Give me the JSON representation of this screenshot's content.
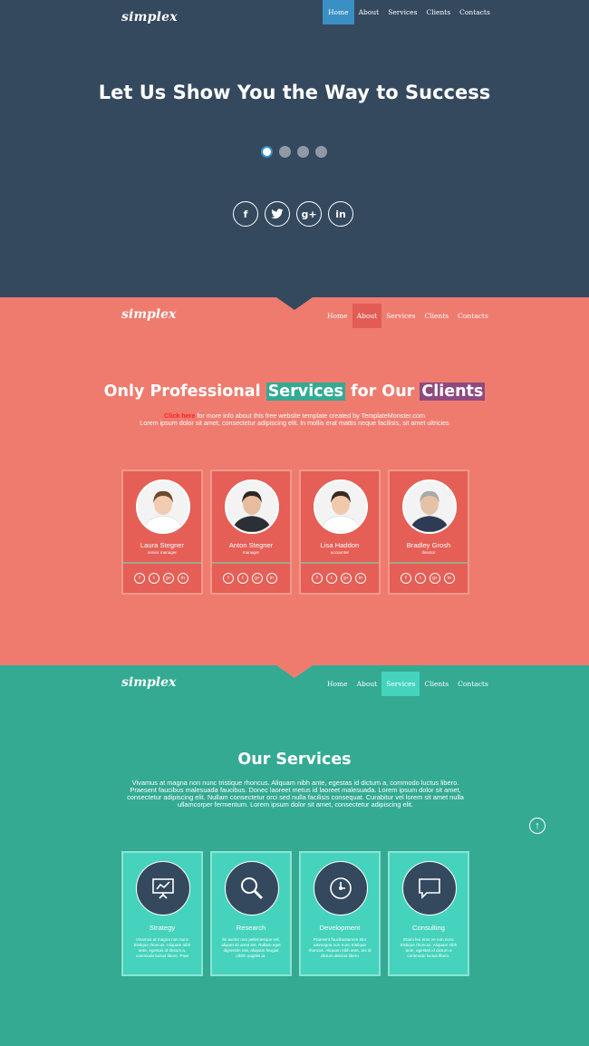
{
  "brand": {
    "logo": "simplex"
  },
  "nav": [
    "Home",
    "About",
    "Services",
    "Clients",
    "Contacts"
  ],
  "hero": {
    "title": "Let Us Show You the Way to Success",
    "slides": 4,
    "active_slide": 1,
    "socials": [
      {
        "icon": "facebook-icon",
        "glyph": "f"
      },
      {
        "icon": "twitter-icon",
        "glyph": "t"
      },
      {
        "icon": "google-plus-icon",
        "glyph": "g+"
      },
      {
        "icon": "linkedin-icon",
        "glyph": "in"
      }
    ]
  },
  "about": {
    "title_part1": "Only Professional ",
    "title_hl1": "Services",
    "title_part2": " for Our ",
    "title_hl2": "Clients",
    "click_here": "Click here",
    "note_rest": " for more info about this free website template created by TemplateMonster.com",
    "note_line2": "Lorem ipsum dolor sit amet, consectetur adipiscing elit. In mollis erat mattis neque facilisis, sit amet ultricies",
    "team": [
      {
        "name": "Laura Stegner",
        "role": "senior manager",
        "hair": "#6b4a2e",
        "skin": "#f2cbb0",
        "suit": "#ffffff"
      },
      {
        "name": "Anton Stegner",
        "role": "manager",
        "hair": "#2d2a26",
        "skin": "#e7bd9e",
        "suit": "#2b2f36"
      },
      {
        "name": "Lisa Haddon",
        "role": "accounter",
        "hair": "#3a2a20",
        "skin": "#f0c8ac",
        "suit": "#ffffff"
      },
      {
        "name": "Bradley Grosh",
        "role": "director",
        "hair": "#a9a9a9",
        "skin": "#e5c1a6",
        "suit": "#2e3b55"
      }
    ],
    "card_socials": [
      "f",
      "t",
      "g+",
      "in"
    ]
  },
  "services": {
    "title": "Our Services",
    "text": "Vivamus at magna non nunc tristique rhoncus. Aliquam nibh ante, egestas id dictum a, commodo luctus libero. Praesent faucibus malesuada faucibus. Donec laoreet metus id laoreet malesuada. Lorem ipsum dolor sit amet, consectetur adipiscing elit. Nullam consectetur orci sed nulla facilisis consequat. Curabitur vel lorem sit amet nulla ullamcorper fermentum.  Lorem ipsum dolor sit amet, consectetur adipiscing elit.",
    "items": [
      {
        "name": "Strategy",
        "icon": "chart-board-icon",
        "desc": "Vivamus at magna non nunc tristique rhoncus. Aliquam nibh ante, egestas id dictum a, commodo luctus libero. Prae"
      },
      {
        "name": "Research",
        "icon": "magnifier-icon",
        "desc": "Ile auctor non pellentesque vel, aliquet sit amet est. Nullam eget dignissim nisi, aliquam feugiat nibhh sagittis ut."
      },
      {
        "name": "Development",
        "icon": "clock-icon",
        "desc": "Praesent faucibustamen stor ammagna non nunc tristique rhoncus. Aliquam nibh ante, tas id dictum alectus libero"
      },
      {
        "name": "Consulting",
        "icon": "chat-bubble-icon",
        "desc": "Etiam leu eros ve non nunc tristique rhoncus. Aliquam nibh ante, egestas id dictum a commodo luctus libero."
      }
    ]
  },
  "colors": {
    "home_bg": "#34495e",
    "about_bg": "#ef7b6f",
    "services_bg": "#34aa93",
    "active_home": "#3a8fc5"
  }
}
